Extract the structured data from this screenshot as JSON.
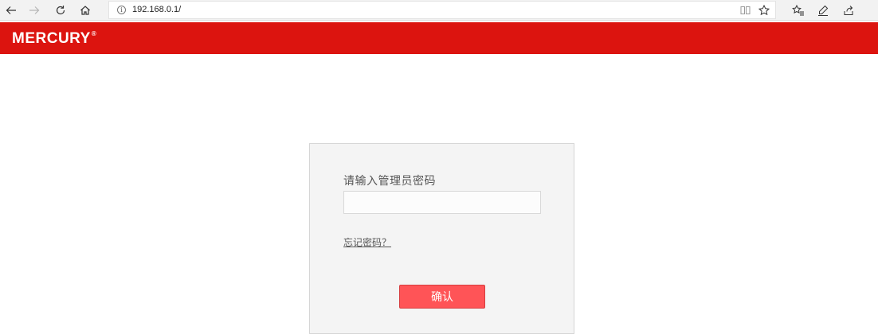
{
  "browser": {
    "url": "192.168.0.1/",
    "icons": {
      "back": "back-arrow-icon",
      "forward": "forward-arrow-icon",
      "refresh": "refresh-icon",
      "home": "home-icon",
      "info": "info-icon",
      "reading_view": "reading-view-icon",
      "favorite": "star-icon",
      "favorites_list": "favorites-list-icon",
      "notes": "pen-icon",
      "share": "share-icon"
    }
  },
  "header": {
    "brand": "MERCURY",
    "brand_mark": "®",
    "color": "#dc140f"
  },
  "login": {
    "password_label": "请输入管理员密码",
    "password_value": "",
    "forgot_link": "忘记密码？",
    "confirm_label": "确认",
    "confirm_color": "#ff5457"
  }
}
